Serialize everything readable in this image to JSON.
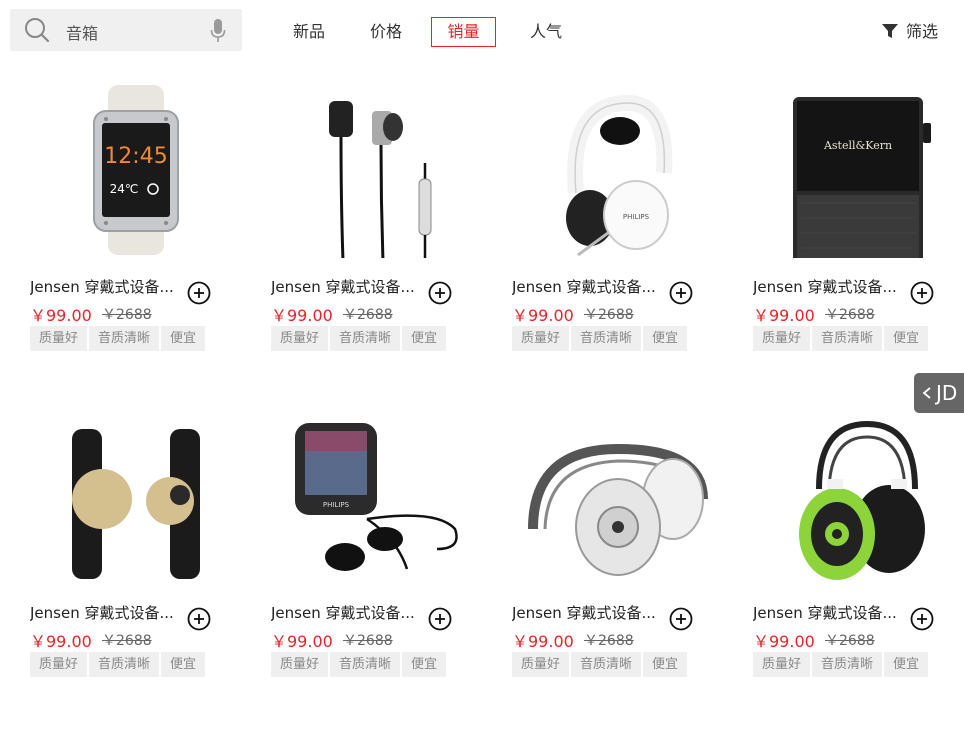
{
  "search": {
    "placeholder": "音箱"
  },
  "sort_tabs": [
    {
      "label": "新品",
      "active": false
    },
    {
      "label": "价格",
      "active": false
    },
    {
      "label": "销量",
      "active": true
    },
    {
      "label": "人气",
      "active": false
    }
  ],
  "filter": {
    "label": "筛选"
  },
  "side_tab": {
    "label": "JD"
  },
  "colors": {
    "accent": "#e4262b",
    "tag_bg": "#efefef",
    "side_tab_bg": "#666666"
  },
  "products": [
    {
      "image": "smartwatch",
      "title": "Jensen 穿戴式设备...",
      "price": "￥99.00",
      "old_price": "￥2688",
      "tags": [
        "质量好",
        "音质清晰",
        "便宜"
      ]
    },
    {
      "image": "earphones",
      "title": "Jensen 穿戴式设备...",
      "price": "￥99.00",
      "old_price": "￥2688",
      "tags": [
        "质量好",
        "音质清晰",
        "便宜"
      ]
    },
    {
      "image": "white-headphones",
      "title": "Jensen 穿戴式设备...",
      "price": "￥99.00",
      "old_price": "￥2688",
      "tags": [
        "质量好",
        "音质清晰",
        "便宜"
      ]
    },
    {
      "image": "music-player",
      "title": "Jensen 穿戴式设备...",
      "price": "￥99.00",
      "old_price": "￥2688",
      "tags": [
        "质量好",
        "音质清晰",
        "便宜"
      ]
    },
    {
      "image": "fitness-tracker",
      "title": "Jensen 穿戴式设备...",
      "price": "￥99.00",
      "old_price": "￥2688",
      "tags": [
        "质量好",
        "音质清晰",
        "便宜"
      ]
    },
    {
      "image": "mp3-player",
      "title": "Jensen 穿戴式设备...",
      "price": "￥99.00",
      "old_price": "￥2688",
      "tags": [
        "质量好",
        "音质清晰",
        "便宜"
      ]
    },
    {
      "image": "studio-headphones",
      "title": "Jensen 穿戴式设备...",
      "price": "￥99.00",
      "old_price": "￥2688",
      "tags": [
        "质量好",
        "音质清晰",
        "便宜"
      ]
    },
    {
      "image": "green-headphones",
      "title": "Jensen 穿戴式设备...",
      "price": "￥99.00",
      "old_price": "￥2688",
      "tags": [
        "质量好",
        "音质清晰",
        "便宜"
      ]
    }
  ],
  "image_text": {
    "watch_time": "12:45",
    "watch_temp": "24℃",
    "brand_philips": "PHILIPS",
    "brand_astell": "Astell&Kern"
  }
}
